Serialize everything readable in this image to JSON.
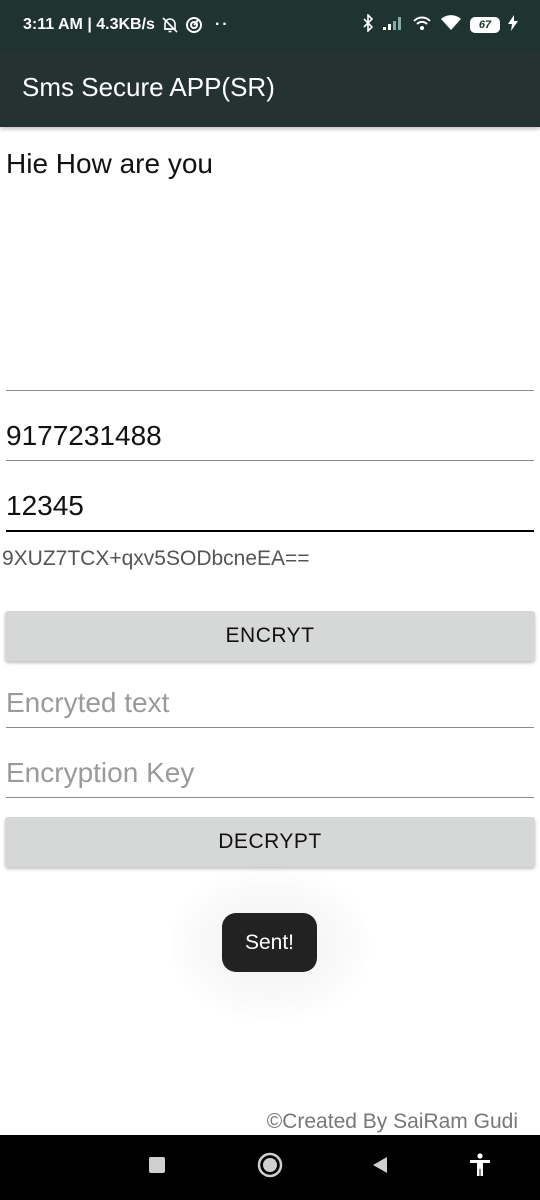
{
  "status_bar": {
    "time_speed": "3:11 AM | 4.3KB/s",
    "overflow_dots": "··",
    "battery_level": "67",
    "icons": [
      "alarm-off-icon",
      "data-saver-icon",
      "bluetooth-icon",
      "signal-icon",
      "wifi-calling-icon",
      "wifi-icon",
      "battery-icon",
      "charging-icon"
    ]
  },
  "app_bar": {
    "title": "Sms Secure APP(SR)"
  },
  "form": {
    "message": "Hie How are you",
    "phone_number": "9177231488",
    "key": "12345",
    "cipher_output": "9XUZ7TCX+qxv5SODbcneEA==",
    "encrypt_button": "ENCRYT",
    "encrypted_text_placeholder": "Encryted text",
    "encryption_key_placeholder": "Encryption Key",
    "decrypt_button": "DECRYPT"
  },
  "toast": {
    "message": "Sent!"
  },
  "footer": {
    "credit": "©Created By SaiRam Gudi"
  },
  "nav_bar": {
    "icons": [
      "recent-apps-icon",
      "home-icon",
      "back-icon",
      "accessibility-icon"
    ]
  },
  "colors": {
    "status_bar": "#1f3331",
    "app_bar": "#253232",
    "button": "#d6d7d7",
    "toast": "#222222",
    "nav_bar": "#000000"
  }
}
